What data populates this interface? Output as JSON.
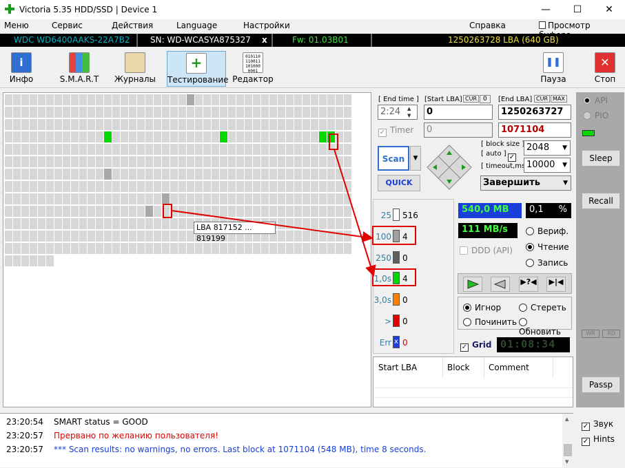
{
  "window": {
    "title": "Victoria 5.35 HDD/SSD | Device 1",
    "minimize": "—",
    "maximize": "☐",
    "close": "✕"
  },
  "menu": {
    "items": [
      "Меню",
      "Сервис",
      "Действия",
      "Language",
      "Настройки",
      "Справка"
    ],
    "buffer": "Просмотр буфера"
  },
  "info": {
    "model": "WDC WD6400AAKS-22A7B2",
    "serial": "SN: WD-WCASYA875327",
    "close_mark": "x",
    "firmware": "Fw: 01.03B01",
    "capacity": "1250263728 LBA (640 GB)"
  },
  "toolbar": {
    "info": "Инфо",
    "smart": "S.M.A.R.T",
    "journals": "Журналы",
    "testing": "Тестирование",
    "editor": "Редактор",
    "pause": "Пауза",
    "stop": "Стоп"
  },
  "tooltip": {
    "lba": "LBA  817152 ... 819199"
  },
  "control": {
    "end_time_label": "[ End time ]",
    "end_time": "2:24",
    "start_lba_label": "[Start LBA]",
    "start_cur": "CUR",
    "start_zero": "0",
    "start_lba": "0",
    "end_lba_label": "[End LBA]",
    "end_cur": "CUR",
    "end_max": "MAX",
    "end_lba": "1250263727",
    "timer_label": "Timer",
    "timer_value": "0",
    "current_lba": "1071104",
    "scan": "Scan",
    "quick": "QUICK",
    "block_size_label": "[ block size ]",
    "auto_label": "[ auto ]",
    "block_size": "2048",
    "timeout_label": "[ timeout,ms ]",
    "timeout": "10000",
    "finish": "Завершить"
  },
  "stats": [
    {
      "name": "25",
      "value": "516",
      "color": "#ffffff"
    },
    {
      "name": "100",
      "value": "4",
      "color": "#a0a0a0"
    },
    {
      "name": "250",
      "value": "0",
      "color": "#606060"
    },
    {
      "name": "1,0s",
      "value": "4",
      "color": "#00d800"
    },
    {
      "name": "3,0s",
      "value": "0",
      "color": "#ff8000"
    },
    {
      "name": ">",
      "value": "0",
      "color": "#e00000"
    },
    {
      "name": "Err",
      "value": "0",
      "color": "#1a3fd8"
    }
  ],
  "readout": {
    "position": "540,0 MB",
    "percent": "0,1",
    "percent_sign": "%",
    "speed": "111 MB/s",
    "ddd": "DDD (API)",
    "timer": "01:08:34",
    "grid": "Grid"
  },
  "mode": {
    "verify": "Вериф.",
    "read": "Чтение",
    "write": "Запись"
  },
  "action": {
    "ignore": "Игнор",
    "erase": "Стереть",
    "repair": "Починить",
    "refresh": "Обновить"
  },
  "table": {
    "headers": [
      "Start LBA",
      "Block",
      "Comment"
    ]
  },
  "side": {
    "api": "API",
    "pio": "PIO",
    "sleep": "Sleep",
    "recall": "Recall",
    "wr": "WR",
    "rd": "RD",
    "passp": "Passp"
  },
  "log": [
    {
      "time": "23:20:54",
      "message": "SMART status = GOOD",
      "color": "#000000"
    },
    {
      "time": "23:20:57",
      "message": "Прервано по желанию пользователя!",
      "color": "#e00000"
    },
    {
      "time": "23:20:57",
      "message": "*** Scan results: no warnings, no errors. Last block at 1071104 (548 MB), time 8 seconds.",
      "color": "#1a3fd8"
    }
  ],
  "options": {
    "sound": "Звук",
    "hints": "Hints"
  },
  "colors": {
    "accent_red": "#e00000",
    "green": "#00d800",
    "info_cyan": "#00b4c8",
    "info_yellow": "#f0e040",
    "lcd_green": "#40ff40"
  }
}
